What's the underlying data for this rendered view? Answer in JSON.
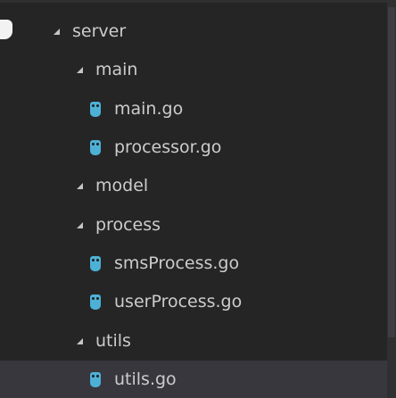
{
  "explorer": {
    "tree": [
      {
        "label": "server",
        "kind": "folder",
        "depth": 0,
        "expanded": true,
        "icon": "expanded-arrow-icon"
      },
      {
        "label": "main",
        "kind": "folder",
        "depth": 1,
        "expanded": true,
        "icon": "expanded-arrow-icon"
      },
      {
        "label": "main.go",
        "kind": "file",
        "depth": 2,
        "icon": "go-file-icon"
      },
      {
        "label": "processor.go",
        "kind": "file",
        "depth": 2,
        "icon": "go-file-icon"
      },
      {
        "label": "model",
        "kind": "folder",
        "depth": 1,
        "expanded": true,
        "icon": "expanded-arrow-icon"
      },
      {
        "label": "process",
        "kind": "folder",
        "depth": 1,
        "expanded": true,
        "icon": "expanded-arrow-icon"
      },
      {
        "label": "smsProcess.go",
        "kind": "file",
        "depth": 2,
        "icon": "go-file-icon"
      },
      {
        "label": "userProcess.go",
        "kind": "file",
        "depth": 2,
        "icon": "go-file-icon"
      },
      {
        "label": "utils",
        "kind": "folder",
        "depth": 1,
        "expanded": true,
        "icon": "expanded-arrow-icon"
      },
      {
        "label": "utils.go",
        "kind": "file",
        "depth": 2,
        "selected": true,
        "icon": "go-file-icon"
      }
    ]
  },
  "colors": {
    "background": "#252526",
    "text": "#cccccc",
    "selected_row": "#37373d",
    "go_icon": "#4db1d6"
  }
}
